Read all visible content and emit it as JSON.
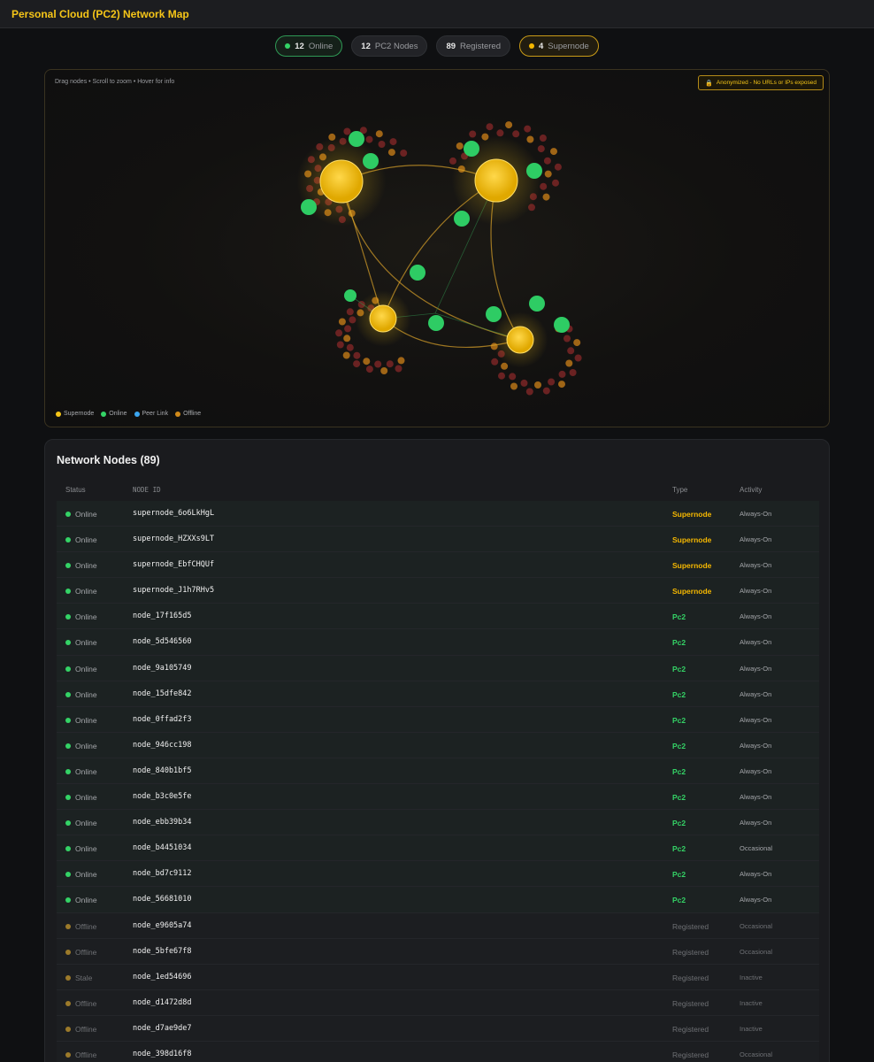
{
  "header": {
    "title": "Personal Cloud (PC2) Network Map"
  },
  "stats": [
    {
      "value": "12",
      "label": "Online",
      "variant": "online"
    },
    {
      "value": "12",
      "label": "PC2 Nodes",
      "variant": "plain"
    },
    {
      "value": "89",
      "label": "Registered",
      "variant": "plain"
    },
    {
      "value": "4",
      "label": "Supernode",
      "variant": "super"
    }
  ],
  "map": {
    "hint": "Drag nodes • Scroll to zoom • Hover for info",
    "anon_badge": "Anonymized - No URLs or IPs exposed",
    "legend": [
      {
        "label": "Supernode",
        "color": "#f5c518"
      },
      {
        "label": "Online",
        "color": "#34d366"
      },
      {
        "label": "Peer Link",
        "color": "#3ba6f0"
      },
      {
        "label": "Offline",
        "color": "#d08a1a"
      }
    ],
    "colors": {
      "supernode": "#f5c518",
      "online": "#2ecc64",
      "offline_dark": "#7a2626",
      "offline_orange": "#b87418",
      "link": "#d9a12a"
    }
  },
  "nodes": {
    "title": "Network Nodes (89)",
    "columns": {
      "status": "Status",
      "node_id": "NODE ID",
      "type": "Type",
      "activity": "Activity"
    },
    "rows": [
      {
        "status": "Online",
        "id": "supernode_6o6LkHgL",
        "type": "Supernode",
        "activity": "Always-On"
      },
      {
        "status": "Online",
        "id": "supernode_HZXXs9LT",
        "type": "Supernode",
        "activity": "Always-On"
      },
      {
        "status": "Online",
        "id": "supernode_EbfCHQUf",
        "type": "Supernode",
        "activity": "Always-On"
      },
      {
        "status": "Online",
        "id": "supernode_J1h7RHv5",
        "type": "Supernode",
        "activity": "Always-On"
      },
      {
        "status": "Online",
        "id": "node_17f165d5",
        "type": "Pc2",
        "activity": "Always-On"
      },
      {
        "status": "Online",
        "id": "node_5d546560",
        "type": "Pc2",
        "activity": "Always-On"
      },
      {
        "status": "Online",
        "id": "node_9a105749",
        "type": "Pc2",
        "activity": "Always-On"
      },
      {
        "status": "Online",
        "id": "node_15dfe842",
        "type": "Pc2",
        "activity": "Always-On"
      },
      {
        "status": "Online",
        "id": "node_0ffad2f3",
        "type": "Pc2",
        "activity": "Always-On"
      },
      {
        "status": "Online",
        "id": "node_946cc198",
        "type": "Pc2",
        "activity": "Always-On"
      },
      {
        "status": "Online",
        "id": "node_840b1bf5",
        "type": "Pc2",
        "activity": "Always-On"
      },
      {
        "status": "Online",
        "id": "node_b3c0e5fe",
        "type": "Pc2",
        "activity": "Always-On"
      },
      {
        "status": "Online",
        "id": "node_ebb39b34",
        "type": "Pc2",
        "activity": "Always-On"
      },
      {
        "status": "Online",
        "id": "node_b4451034",
        "type": "Pc2",
        "activity": "Occasional"
      },
      {
        "status": "Online",
        "id": "node_bd7c9112",
        "type": "Pc2",
        "activity": "Always-On"
      },
      {
        "status": "Online",
        "id": "node_56681010",
        "type": "Pc2",
        "activity": "Always-On"
      },
      {
        "status": "Offline",
        "id": "node_e9605a74",
        "type": "Registered",
        "activity": "Occasional"
      },
      {
        "status": "Offline",
        "id": "node_5bfe67f8",
        "type": "Registered",
        "activity": "Occasional"
      },
      {
        "status": "Stale",
        "id": "node_1ed54696",
        "type": "Registered",
        "activity": "Inactive"
      },
      {
        "status": "Offline",
        "id": "node_d1472d8d",
        "type": "Registered",
        "activity": "Inactive"
      },
      {
        "status": "Offline",
        "id": "node_d7ae9de7",
        "type": "Registered",
        "activity": "Inactive"
      },
      {
        "status": "Offline",
        "id": "node_398d16f8",
        "type": "Registered",
        "activity": "Occasional"
      }
    ]
  }
}
